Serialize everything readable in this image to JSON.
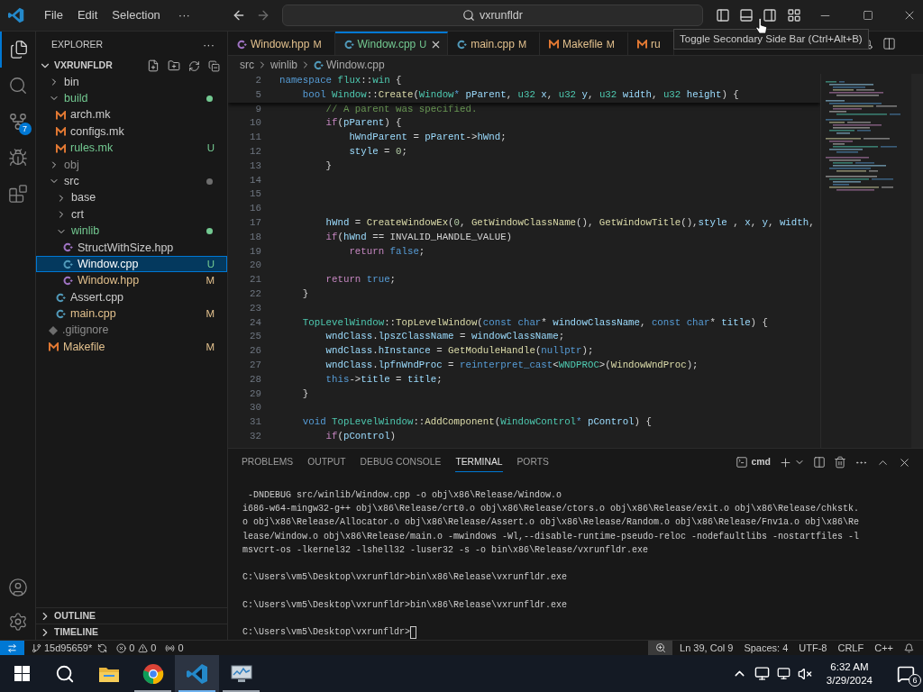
{
  "title_bar": {
    "menus": [
      "File",
      "Edit",
      "Selection"
    ],
    "more": "···",
    "search": "vxrunfldr",
    "tooltip": "Toggle Secondary Side Bar (Ctrl+Alt+B)"
  },
  "activity_bar": [
    {
      "kind": "files",
      "selected": true
    },
    {
      "kind": "search",
      "selected": false
    },
    {
      "kind": "scm",
      "selected": false,
      "badge": "7"
    },
    {
      "kind": "debug",
      "selected": false
    },
    {
      "kind": "extensions",
      "selected": false
    }
  ],
  "sidebar": {
    "title": "EXPLORER",
    "more": "···",
    "root": {
      "label": "VXRUNFLDR",
      "expanded": true
    },
    "tree": [
      {
        "label": "bin",
        "kind": "folder",
        "expanded": false,
        "selected": false
      },
      {
        "label": "build",
        "kind": "folder",
        "expanded": true,
        "selected": false,
        "color": "#73c991",
        "dot": true,
        "children": [
          {
            "label": "arch.mk",
            "kind": "make",
            "selected": false
          },
          {
            "label": "configs.mk",
            "kind": "make",
            "selected": false
          },
          {
            "label": "rules.mk",
            "kind": "make",
            "selected": false,
            "color": "#73c991",
            "status": "U"
          }
        ]
      },
      {
        "label": "obj",
        "kind": "folder",
        "expanded": false,
        "selected": false,
        "color": "#8c8c8c"
      },
      {
        "label": "src",
        "kind": "folder",
        "expanded": true,
        "selected": false,
        "dot": true,
        "children": [
          {
            "label": "base",
            "kind": "folder",
            "expanded": false,
            "selected": false
          },
          {
            "label": "crt",
            "kind": "folder",
            "expanded": false,
            "selected": false
          },
          {
            "label": "winlib",
            "kind": "folder",
            "expanded": true,
            "selected": false,
            "color": "#73c991",
            "dot": true,
            "children": [
              {
                "label": "StructWithSize.hpp",
                "kind": "hpp",
                "selected": false
              },
              {
                "label": "Window.cpp",
                "kind": "cpp",
                "selected": true,
                "status": "U"
              },
              {
                "label": "Window.hpp",
                "kind": "hpp",
                "selected": false,
                "color": "#e2c08d",
                "status": "M"
              }
            ]
          },
          {
            "label": "Assert.cpp",
            "kind": "cpp",
            "selected": false
          },
          {
            "label": "main.cpp",
            "kind": "cpp",
            "selected": false,
            "color": "#e2c08d",
            "status": "M"
          }
        ]
      },
      {
        "label": ".gitignore",
        "kind": "gitignore",
        "selected": false,
        "color": "#8c8c8c"
      },
      {
        "label": "Makefile",
        "kind": "make",
        "selected": false,
        "color": "#e2c08d",
        "status": "M"
      }
    ],
    "sections": [
      {
        "label": "OUTLINE",
        "expanded": false
      },
      {
        "label": "TIMELINE",
        "expanded": false
      }
    ]
  },
  "tabs": [
    {
      "label": "Window.hpp",
      "kind": "hpp",
      "status": "M",
      "color": "#e2c08d",
      "selected": false
    },
    {
      "label": "Window.cpp",
      "kind": "cpp",
      "status": "U",
      "color": "#73c991",
      "selected": true
    },
    {
      "label": "main.cpp",
      "kind": "cpp",
      "status": "M",
      "color": "#e2c08d",
      "selected": false
    },
    {
      "label": "Makefile",
      "kind": "make",
      "status": "M",
      "color": "#e2c08d",
      "selected": false
    },
    {
      "label": "ru",
      "kind": "make",
      "color": "#e2c08d",
      "selected": false
    }
  ],
  "breadcrumb": [
    "src",
    "winlib",
    "Window.cpp"
  ],
  "editor": {
    "sticky": [
      {
        "number": "2",
        "tokens": [
          {
            "kind": "kw",
            "t": "namespace "
          },
          {
            "kind": "type",
            "t": "flux"
          },
          {
            "kind": "pl",
            "t": "::"
          },
          {
            "kind": "type",
            "t": "win"
          },
          {
            "kind": "pl",
            "t": " {"
          }
        ]
      },
      {
        "number": "5",
        "tokens": [
          {
            "kind": "kw",
            "t": "    bool "
          },
          {
            "kind": "type",
            "t": "Window"
          },
          {
            "kind": "pl",
            "t": "::"
          },
          {
            "kind": "fn",
            "t": "Create"
          },
          {
            "kind": "pl",
            "t": "("
          },
          {
            "kind": "type",
            "t": "Window"
          },
          {
            "kind": "kw",
            "t": "*"
          },
          {
            "kind": "var",
            "t": " pParent"
          },
          {
            "kind": "pl",
            "t": ", "
          },
          {
            "kind": "type",
            "t": "u32"
          },
          {
            "kind": "var",
            "t": " x"
          },
          {
            "kind": "pl",
            "t": ", "
          },
          {
            "kind": "type",
            "t": "u32"
          },
          {
            "kind": "var",
            "t": " y"
          },
          {
            "kind": "pl",
            "t": ", "
          },
          {
            "kind": "type",
            "t": "u32"
          },
          {
            "kind": "var",
            "t": " width"
          },
          {
            "kind": "pl",
            "t": ", "
          },
          {
            "kind": "type",
            "t": "u32"
          },
          {
            "kind": "var",
            "t": " height"
          },
          {
            "kind": "pl",
            "t": ") {"
          }
        ]
      }
    ],
    "lines": [
      {
        "number": "9",
        "tokens": [
          {
            "kind": "com",
            "t": "        // A parent was specified."
          }
        ]
      },
      {
        "number": "10",
        "tokens": [
          {
            "kind": "ctl",
            "t": "        if"
          },
          {
            "kind": "pl",
            "t": "("
          },
          {
            "kind": "var",
            "t": "pParent"
          },
          {
            "kind": "pl",
            "t": ") {"
          }
        ]
      },
      {
        "number": "11",
        "tokens": [
          {
            "kind": "var",
            "t": "            hWndParent"
          },
          {
            "kind": "pl",
            "t": " = "
          },
          {
            "kind": "var",
            "t": "pParent"
          },
          {
            "kind": "pl",
            "t": "->"
          },
          {
            "kind": "var",
            "t": "hWnd"
          },
          {
            "kind": "pl",
            "t": ";"
          }
        ]
      },
      {
        "number": "12",
        "tokens": [
          {
            "kind": "var",
            "t": "            style"
          },
          {
            "kind": "pl",
            "t": " = "
          },
          {
            "kind": "num",
            "t": "0"
          },
          {
            "kind": "pl",
            "t": ";"
          }
        ]
      },
      {
        "number": "13",
        "tokens": [
          {
            "kind": "pl",
            "t": "        }"
          }
        ]
      },
      {
        "number": "14"
      },
      {
        "number": "15"
      },
      {
        "number": "16"
      },
      {
        "number": "17",
        "tokens": [
          {
            "kind": "var",
            "t": "        hWnd"
          },
          {
            "kind": "pl",
            "t": " = "
          },
          {
            "kind": "fn",
            "t": "CreateWindowEx"
          },
          {
            "kind": "pl",
            "t": "("
          },
          {
            "kind": "num",
            "t": "0"
          },
          {
            "kind": "pl",
            "t": ", "
          },
          {
            "kind": "fn",
            "t": "GetWindowClassName"
          },
          {
            "kind": "pl",
            "t": "(), "
          },
          {
            "kind": "fn",
            "t": "GetWindowTitle"
          },
          {
            "kind": "pl",
            "t": "(),"
          },
          {
            "kind": "var",
            "t": "style"
          },
          {
            "kind": "pl",
            "t": " , "
          },
          {
            "kind": "var",
            "t": "x"
          },
          {
            "kind": "pl",
            "t": ", "
          },
          {
            "kind": "var",
            "t": "y"
          },
          {
            "kind": "pl",
            "t": ", "
          },
          {
            "kind": "var",
            "t": "width"
          },
          {
            "kind": "pl",
            "t": ","
          }
        ]
      },
      {
        "number": "18",
        "tokens": [
          {
            "kind": "ctl",
            "t": "        if"
          },
          {
            "kind": "pl",
            "t": "("
          },
          {
            "kind": "var",
            "t": "hWnd"
          },
          {
            "kind": "pl",
            "t": " == INVALID_HANDLE_VALUE)"
          }
        ]
      },
      {
        "number": "19",
        "tokens": [
          {
            "kind": "ctl",
            "t": "            return "
          },
          {
            "kind": "kw",
            "t": "false"
          },
          {
            "kind": "pl",
            "t": ";"
          }
        ]
      },
      {
        "number": "20"
      },
      {
        "number": "21",
        "tokens": [
          {
            "kind": "ctl",
            "t": "        return "
          },
          {
            "kind": "kw",
            "t": "true"
          },
          {
            "kind": "pl",
            "t": ";"
          }
        ]
      },
      {
        "number": "22",
        "tokens": [
          {
            "kind": "pl",
            "t": "    }"
          }
        ]
      },
      {
        "number": "23"
      },
      {
        "number": "24",
        "tokens": [
          {
            "kind": "type",
            "t": "    TopLevelWindow"
          },
          {
            "kind": "pl",
            "t": "::"
          },
          {
            "kind": "fn",
            "t": "TopLevelWindow"
          },
          {
            "kind": "pl",
            "t": "("
          },
          {
            "kind": "kw",
            "t": "const char"
          },
          {
            "kind": "pl",
            "t": "* "
          },
          {
            "kind": "var",
            "t": "windowClassName"
          },
          {
            "kind": "pl",
            "t": ", "
          },
          {
            "kind": "kw",
            "t": "const char"
          },
          {
            "kind": "pl",
            "t": "* "
          },
          {
            "kind": "var",
            "t": "title"
          },
          {
            "kind": "pl",
            "t": ") {"
          }
        ]
      },
      {
        "number": "25",
        "tokens": [
          {
            "kind": "var",
            "t": "        wndClass"
          },
          {
            "kind": "pl",
            "t": "."
          },
          {
            "kind": "var",
            "t": "lpszClassName"
          },
          {
            "kind": "pl",
            "t": " = "
          },
          {
            "kind": "var",
            "t": "windowClassName"
          },
          {
            "kind": "pl",
            "t": ";"
          }
        ]
      },
      {
        "number": "26",
        "tokens": [
          {
            "kind": "var",
            "t": "        wndClass"
          },
          {
            "kind": "pl",
            "t": "."
          },
          {
            "kind": "var",
            "t": "hInstance"
          },
          {
            "kind": "pl",
            "t": " = "
          },
          {
            "kind": "fn",
            "t": "GetModuleHandle"
          },
          {
            "kind": "pl",
            "t": "("
          },
          {
            "kind": "kw",
            "t": "nullptr"
          },
          {
            "kind": "pl",
            "t": ");"
          }
        ]
      },
      {
        "number": "27",
        "tokens": [
          {
            "kind": "var",
            "t": "        wndClass"
          },
          {
            "kind": "pl",
            "t": "."
          },
          {
            "kind": "var",
            "t": "lpfnWndProc"
          },
          {
            "kind": "pl",
            "t": " = "
          },
          {
            "kind": "kw",
            "t": "reinterpret_cast"
          },
          {
            "kind": "pl",
            "t": "<"
          },
          {
            "kind": "type",
            "t": "WNDPROC"
          },
          {
            "kind": "pl",
            "t": ">("
          },
          {
            "kind": "fn",
            "t": "WindowWndProc"
          },
          {
            "kind": "pl",
            "t": ");"
          }
        ]
      },
      {
        "number": "28",
        "tokens": [
          {
            "kind": "kw",
            "t": "        this"
          },
          {
            "kind": "pl",
            "t": "->"
          },
          {
            "kind": "var",
            "t": "title"
          },
          {
            "kind": "pl",
            "t": " = "
          },
          {
            "kind": "var",
            "t": "title"
          },
          {
            "kind": "pl",
            "t": ";"
          }
        ]
      },
      {
        "number": "29",
        "tokens": [
          {
            "kind": "pl",
            "t": "    }"
          }
        ]
      },
      {
        "number": "30"
      },
      {
        "number": "31",
        "tokens": [
          {
            "kind": "kw",
            "t": "    void "
          },
          {
            "kind": "type",
            "t": "TopLevelWindow"
          },
          {
            "kind": "pl",
            "t": "::"
          },
          {
            "kind": "fn",
            "t": "AddComponent"
          },
          {
            "kind": "pl",
            "t": "("
          },
          {
            "kind": "type",
            "t": "WindowControl"
          },
          {
            "kind": "kw",
            "t": "*"
          },
          {
            "kind": "var",
            "t": " pControl"
          },
          {
            "kind": "pl",
            "t": ") {"
          }
        ]
      },
      {
        "number": "32",
        "tokens": [
          {
            "kind": "ctl",
            "t": "        if"
          },
          {
            "kind": "pl",
            "t": "("
          },
          {
            "kind": "var",
            "t": "pControl"
          },
          {
            "kind": "pl",
            "t": ")"
          }
        ]
      }
    ]
  },
  "panel": {
    "tabs": [
      {
        "label": "PROBLEMS",
        "selected": false
      },
      {
        "label": "OUTPUT",
        "selected": false
      },
      {
        "label": "DEBUG CONSOLE",
        "selected": false
      },
      {
        "label": "TERMINAL",
        "selected": true
      },
      {
        "label": "PORTS",
        "selected": false
      }
    ],
    "shell": "cmd",
    "terminal": [
      [
        " -DNDEBUG src/winlib/Window.cpp -o obj\\x86\\Release/Window.o",
        "i686-w64-mingw32-g++ obj\\x86\\Release/crt0.o obj\\x86\\Release/ctors.o obj\\x86\\Release/exit.o obj\\x86\\Release/chkstk.",
        "o obj\\x86\\Release/Allocator.o obj\\x86\\Release/Assert.o obj\\x86\\Release/Random.o obj\\x86\\Release/Fnv1a.o obj\\x86\\Re",
        "lease/Window.o obj\\x86\\Release/main.o -mwindows -Wl,--disable-runtime-pseudo-reloc -nodefaultlibs -nostartfiles -l",
        "msvcrt-os -lkernel32 -lshell32 -luser32 -s -o bin\\x86\\Release/vxrunfldr.exe"
      ],
      [
        "C:\\Users\\vm5\\Desktop\\vxrunfldr>bin\\x86\\Release\\vxrunfldr.exe"
      ],
      [
        "C:\\Users\\vm5\\Desktop\\vxrunfldr>bin\\x86\\Release\\vxrunfldr.exe"
      ],
      [
        "C:\\Users\\vm5\\Desktop\\vxrunfldr>"
      ]
    ]
  },
  "status_bar": {
    "branch": "15d95659*",
    "errors": "0",
    "warnings": "0",
    "ports": "0",
    "position": "Ln 39, Col 9",
    "indent": "Spaces: 4",
    "encoding": "UTF-8",
    "eol": "CRLF",
    "language": "C++"
  },
  "taskbar": {
    "apps": [
      {
        "kind": "files",
        "running": false,
        "active": false
      },
      {
        "kind": "browser",
        "running": true,
        "active": false
      },
      {
        "kind": "editor",
        "running": true,
        "active": true
      },
      {
        "kind": "monitor",
        "running": true,
        "active": false
      }
    ],
    "time": "6:32 AM",
    "date": "3/29/2024",
    "notifications": "6"
  }
}
